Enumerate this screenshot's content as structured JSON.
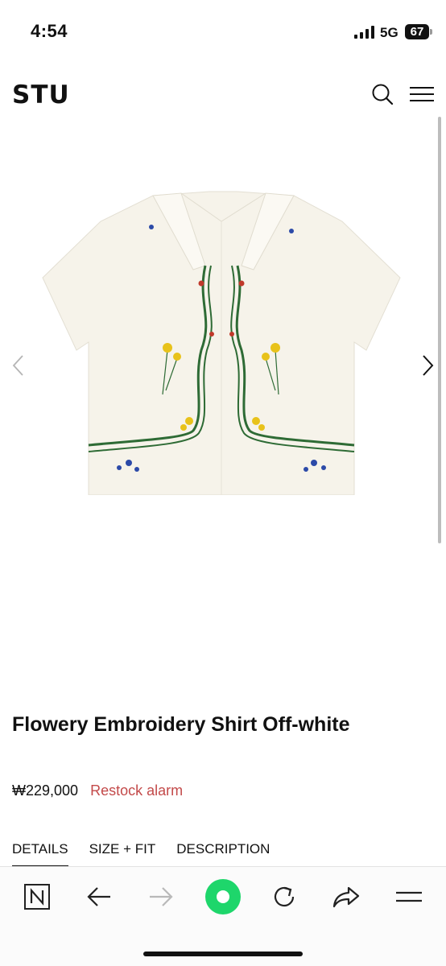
{
  "status_bar": {
    "time": "4:54",
    "network": "5G",
    "battery": "67"
  },
  "header": {
    "logo": "STU",
    "search_icon": "search-icon",
    "menu_icon": "hamburger-menu-icon"
  },
  "gallery": {
    "prev_icon": "chevron-left-icon",
    "next_icon": "chevron-right-icon"
  },
  "product": {
    "title": "Flowery Embroidery Shirt Off-white",
    "price": "₩229,000",
    "restock_label": "Restock alarm"
  },
  "tabs": [
    {
      "label": "DETAILS",
      "active": true
    },
    {
      "label": "SIZE + FIT",
      "active": false
    },
    {
      "label": "DESCRIPTION",
      "active": false
    }
  ],
  "toolbar": {
    "items": [
      "naver-n-icon",
      "back-arrow-icon",
      "forward-arrow-icon",
      "green-circle-icon",
      "refresh-icon",
      "share-icon",
      "menu-lines-icon"
    ]
  },
  "colors": {
    "restock": "#c34a4a",
    "green_button": "#1ed66b",
    "shirt": "#f5f2ea"
  }
}
